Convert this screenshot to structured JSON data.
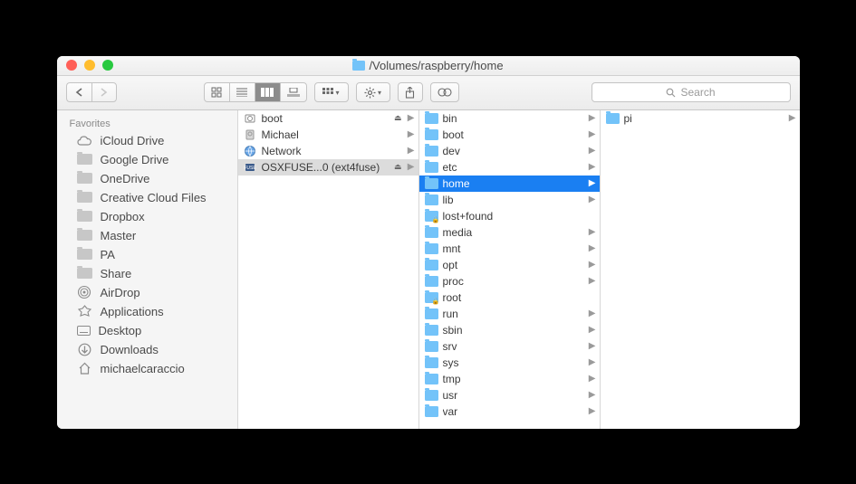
{
  "window_title": "/Volumes/raspberry/home",
  "search_placeholder": "Search",
  "sidebar": {
    "heading": "Favorites",
    "items": [
      {
        "label": "iCloud Drive",
        "icon": "cloud"
      },
      {
        "label": "Google Drive",
        "icon": "folder"
      },
      {
        "label": "OneDrive",
        "icon": "folder"
      },
      {
        "label": "Creative Cloud Files",
        "icon": "folder"
      },
      {
        "label": "Dropbox",
        "icon": "folder"
      },
      {
        "label": "Master",
        "icon": "folder"
      },
      {
        "label": "PA",
        "icon": "folder"
      },
      {
        "label": "Share",
        "icon": "folder"
      },
      {
        "label": "AirDrop",
        "icon": "airdrop"
      },
      {
        "label": "Applications",
        "icon": "apps"
      },
      {
        "label": "Desktop",
        "icon": "disk"
      },
      {
        "label": "Downloads",
        "icon": "downloads"
      },
      {
        "label": "michaelcaraccio",
        "icon": "home"
      }
    ]
  },
  "columns": [
    {
      "items": [
        {
          "name": "boot",
          "icon": "disk",
          "eject": true,
          "chevron": true
        },
        {
          "name": "Michael",
          "icon": "hdd",
          "chevron": true
        },
        {
          "name": "Network",
          "icon": "globe",
          "chevron": true
        },
        {
          "name": "OSXFUSE...0 (ext4fuse)",
          "icon": "fuse",
          "eject": true,
          "chevron": true,
          "selected": "dim"
        }
      ]
    },
    {
      "items": [
        {
          "name": "bin",
          "icon": "folder",
          "chevron": true
        },
        {
          "name": "boot",
          "icon": "folder",
          "chevron": true
        },
        {
          "name": "dev",
          "icon": "folder",
          "chevron": true
        },
        {
          "name": "etc",
          "icon": "folder",
          "chevron": true
        },
        {
          "name": "home",
          "icon": "folder",
          "chevron": true,
          "selected": "active"
        },
        {
          "name": "lib",
          "icon": "folder",
          "chevron": true
        },
        {
          "name": "lost+found",
          "icon": "folder-locked"
        },
        {
          "name": "media",
          "icon": "folder",
          "chevron": true
        },
        {
          "name": "mnt",
          "icon": "folder",
          "chevron": true
        },
        {
          "name": "opt",
          "icon": "folder",
          "chevron": true
        },
        {
          "name": "proc",
          "icon": "folder",
          "chevron": true
        },
        {
          "name": "root",
          "icon": "folder-locked"
        },
        {
          "name": "run",
          "icon": "folder",
          "chevron": true
        },
        {
          "name": "sbin",
          "icon": "folder",
          "chevron": true
        },
        {
          "name": "srv",
          "icon": "folder",
          "chevron": true
        },
        {
          "name": "sys",
          "icon": "folder",
          "chevron": true
        },
        {
          "name": "tmp",
          "icon": "folder",
          "chevron": true
        },
        {
          "name": "usr",
          "icon": "folder",
          "chevron": true
        },
        {
          "name": "var",
          "icon": "folder",
          "chevron": true
        }
      ]
    },
    {
      "items": [
        {
          "name": "pi",
          "icon": "folder",
          "chevron": true
        }
      ]
    }
  ]
}
